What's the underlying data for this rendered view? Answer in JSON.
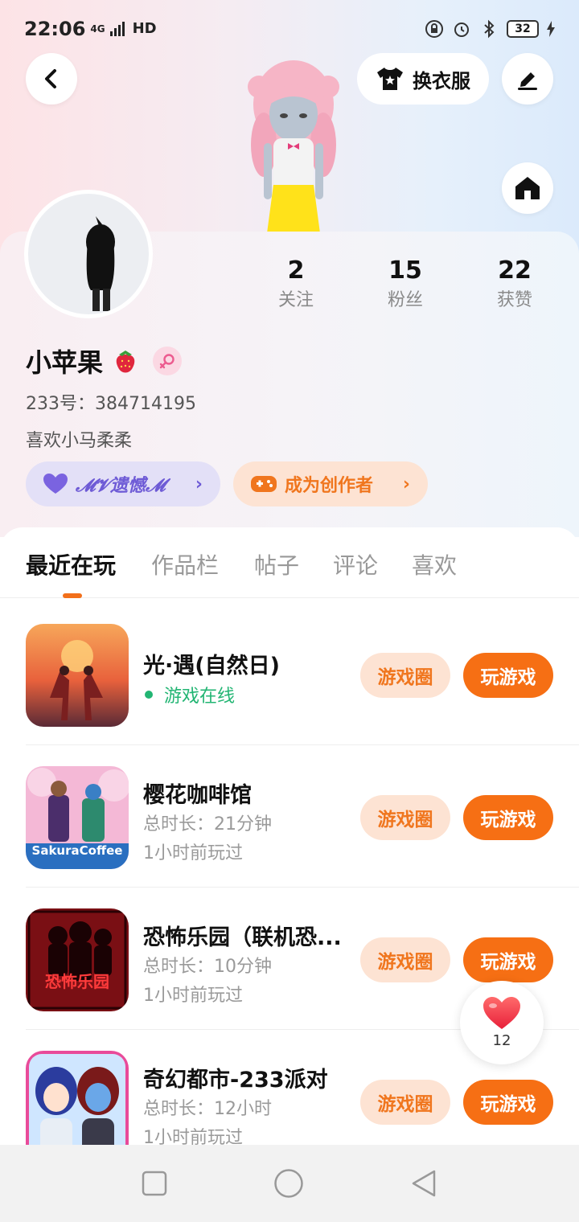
{
  "status_bar": {
    "time": "22:06",
    "network": "4G",
    "hd": "HD",
    "battery": "32"
  },
  "header": {
    "outfit_label": "换衣服"
  },
  "profile": {
    "username": "小苹果",
    "uid_label": "233号：384714195",
    "bio": "喜欢小马柔柔",
    "stats": [
      {
        "value": "2",
        "label": "关注"
      },
      {
        "value": "15",
        "label": "粉丝"
      },
      {
        "value": "22",
        "label": "获赞"
      }
    ],
    "title_pill": "𝓜𝓥遗憾𝓜",
    "creator_pill": "成为创作者"
  },
  "tabs": [
    {
      "label": "最近在玩",
      "active": true
    },
    {
      "label": "作品栏"
    },
    {
      "label": "帖子"
    },
    {
      "label": "评论"
    },
    {
      "label": "喜欢"
    }
  ],
  "games": [
    {
      "name": "光·遇(自然日)",
      "status": "游戏在线"
    },
    {
      "name": "樱花咖啡馆",
      "duration": "总时长：21分钟",
      "last_played": "1小时前玩过",
      "icon_text": "SakuraCoffee"
    },
    {
      "name": "恐怖乐园（联机恐...",
      "duration": "总时长：10分钟",
      "last_played": "1小时前玩过",
      "icon_text": "恐怖乐园"
    },
    {
      "name": "奇幻都市-233派对",
      "duration": "总时长：12小时",
      "last_played": "1小时前玩过"
    }
  ],
  "buttons": {
    "circle_label": "游戏圈",
    "play_label": "玩游戏"
  },
  "like_float": {
    "count": "12"
  },
  "colors": {
    "accent": "#f66f14",
    "accent_light": "#fde3d3",
    "online": "#22b573",
    "title_pill_bg": "#e3e0f7",
    "title_pill_fg": "#6e5bd6"
  }
}
